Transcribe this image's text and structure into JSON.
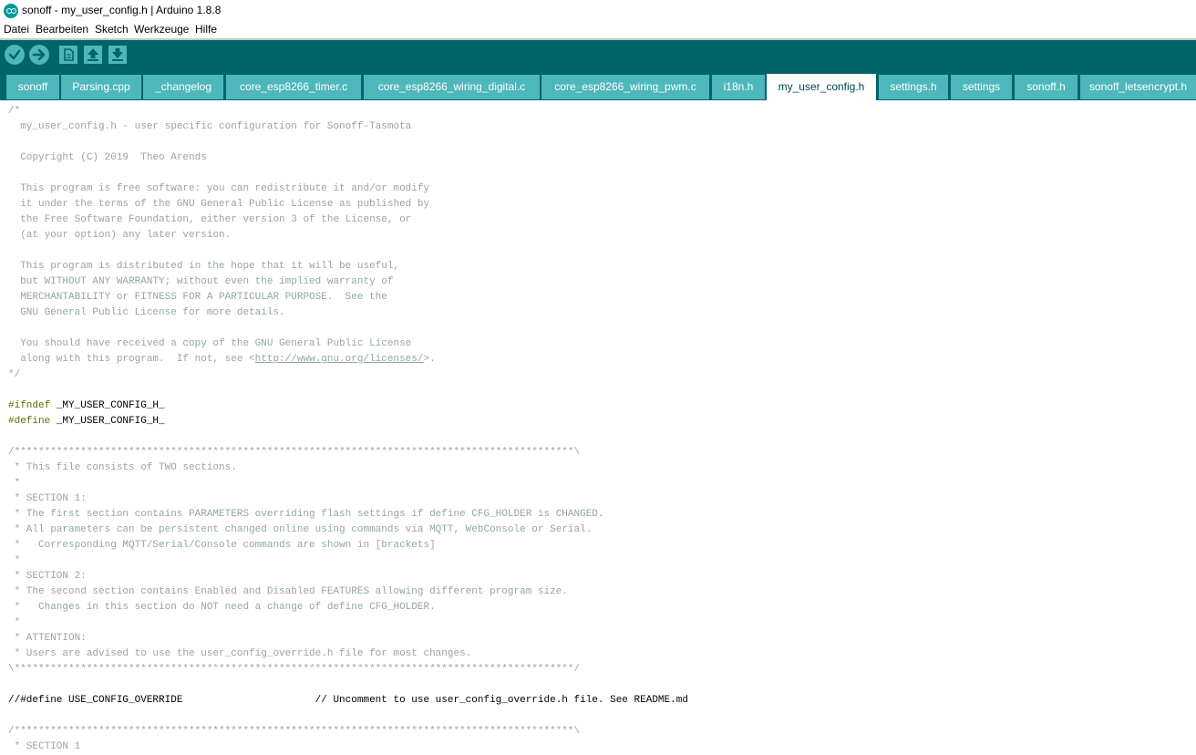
{
  "window": {
    "title": "sonoff - my_user_config.h | Arduino 1.8.8"
  },
  "menu": [
    "Datei",
    "Bearbeiten",
    "Sketch",
    "Werkzeuge",
    "Hilfe"
  ],
  "toolbar": [
    {
      "name": "verify-button",
      "icon": "check-icon"
    },
    {
      "name": "upload-button",
      "icon": "arrow-right-icon"
    },
    {
      "name": "new-button",
      "icon": "new-file-icon"
    },
    {
      "name": "open-button",
      "icon": "arrow-up-icon"
    },
    {
      "name": "save-button",
      "icon": "arrow-down-icon"
    }
  ],
  "tabs": [
    {
      "label": "sonoff"
    },
    {
      "label": "Parsing.cpp"
    },
    {
      "label": "_changelog"
    },
    {
      "label": "core_esp8266_timer.c"
    },
    {
      "label": "core_esp8266_wiring_digital.c"
    },
    {
      "label": "core_esp8266_wiring_pwm.c"
    },
    {
      "label": "i18n.h"
    },
    {
      "label": "my_user_config.h",
      "active": true
    },
    {
      "label": "settings.h"
    },
    {
      "label": "settings"
    },
    {
      "label": "sonoff.h"
    },
    {
      "label": "sonoff_letsencrypt.h"
    }
  ],
  "code": {
    "lines": [
      {
        "t": "/*",
        "c": "cmt"
      },
      {
        "t": "  my_user_config.h - user specific configuration for Sonoff-Tasmota",
        "c": "cmt"
      },
      {
        "t": "",
        "c": ""
      },
      {
        "t": "  Copyright (C) 2019  Theo Arends",
        "c": "cmt"
      },
      {
        "t": "",
        "c": ""
      },
      {
        "t": "  This program is free software: you can redistribute it and/or modify",
        "c": "cmt"
      },
      {
        "t": "  it under the terms of the GNU General Public License as published by",
        "c": "cmt"
      },
      {
        "t": "  the Free Software Foundation, either version 3 of the License, or",
        "c": "cmt"
      },
      {
        "t": "  (at your option) any later version.",
        "c": "cmt"
      },
      {
        "t": "",
        "c": ""
      },
      {
        "t": "  This program is distributed in the hope that it will be useful,",
        "c": "cmt"
      },
      {
        "t": "  but WITHOUT ANY WARRANTY; without even the implied warranty of",
        "c": "cmt"
      },
      {
        "t": "  MERCHANTABILITY or FITNESS FOR A PARTICULAR PURPOSE.  See the",
        "c": "cmt"
      },
      {
        "t": "  GNU General Public License for more details.",
        "c": "cmt"
      },
      {
        "t": "",
        "c": ""
      },
      {
        "t": "  You should have received a copy of the GNU General Public License",
        "c": "cmt"
      },
      {
        "t": "  along with this program.  If not, see <",
        "c": "cmt",
        "link": "http://www.gnu.org/licenses/",
        "after": ">."
      },
      {
        "t": "*/",
        "c": "cmt"
      },
      {
        "t": "",
        "c": ""
      },
      {
        "t": "#ifndef",
        "c": "pp",
        "after_plain": " _MY_USER_CONFIG_H_"
      },
      {
        "t": "#define",
        "c": "pp",
        "after_plain": " _MY_USER_CONFIG_H_"
      },
      {
        "t": "",
        "c": ""
      },
      {
        "t": "/*********************************************************************************************\\",
        "c": "cmt"
      },
      {
        "t": " * This file consists of TWO sections.",
        "c": "cmt"
      },
      {
        "t": " *",
        "c": "cmt"
      },
      {
        "t": " * SECTION 1:",
        "c": "cmt"
      },
      {
        "t": " * The first section contains PARAMETERS overriding flash settings if define CFG_HOLDER is CHANGED.",
        "c": "cmt"
      },
      {
        "t": " * All parameters can be persistent changed online using commands via MQTT, WebConsole or Serial.",
        "c": "cmt"
      },
      {
        "t": " *   Corresponding MQTT/Serial/Console commands are shown in [brackets]",
        "c": "cmt"
      },
      {
        "t": " *",
        "c": "cmt"
      },
      {
        "t": " * SECTION 2:",
        "c": "cmt"
      },
      {
        "t": " * The second section contains Enabled and Disabled FEATURES allowing different program size.",
        "c": "cmt"
      },
      {
        "t": " *   Changes in this section do NOT need a change of define CFG_HOLDER.",
        "c": "cmt"
      },
      {
        "t": " *",
        "c": "cmt"
      },
      {
        "t": " * ATTENTION:",
        "c": "cmt"
      },
      {
        "t": " * Users are advised to use the user_config_override.h file for most changes.",
        "c": "cmt"
      },
      {
        "t": "\\*********************************************************************************************/",
        "c": "cmt"
      },
      {
        "t": "",
        "c": ""
      },
      {
        "t": "//#define USE_CONFIG_OVERRIDE                      // Uncomment to use user_config_override.h file. See README.md",
        "c": ""
      },
      {
        "t": "",
        "c": ""
      },
      {
        "t": "/*********************************************************************************************\\",
        "c": "cmt"
      },
      {
        "t": " * SECTION 1",
        "c": "cmt"
      }
    ]
  }
}
